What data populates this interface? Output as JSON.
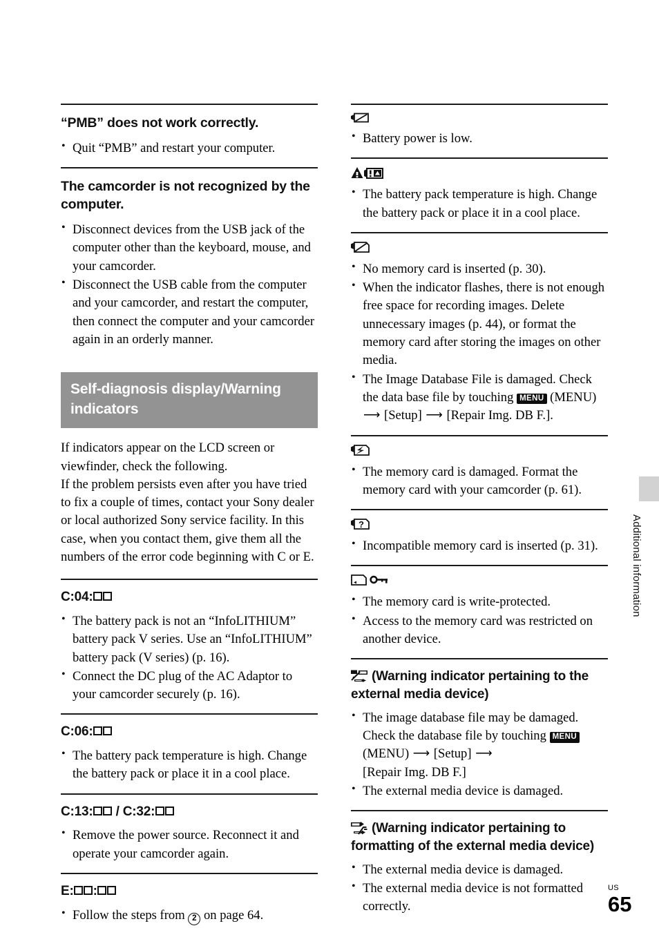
{
  "page": {
    "folio_region": "US",
    "folio_number": "65",
    "side_tab_label": "Additional information",
    "banner_color": "#939393",
    "side_tab_color": "#d2d2d2"
  },
  "left_column": {
    "sections": [
      {
        "id": "pmb-not-working",
        "heading": "“PMB” does not work correctly.",
        "bullets": [
          "Quit “PMB” and restart your computer."
        ]
      },
      {
        "id": "camcorder-not-recognized",
        "heading": "The camcorder is not recognized by the computer.",
        "bullets": [
          "Disconnect devices from the USB jack of the computer other than the keyboard, mouse, and your camcorder.",
          "Disconnect the USB cable from the computer and your camcorder, and restart the computer, then connect the computer and your camcorder again in an orderly manner."
        ]
      }
    ],
    "banner_title": "Self-diagnosis display/Warning indicators",
    "intro_paragraph": "If indicators appear on the LCD screen or viewfinder, check the following.\nIf the problem persists even after you have tried to fix a couple of times, contact your Sony dealer or local authorized Sony service facility. In this case, when you contact them, give them all the numbers of the error code beginning with C or E.",
    "code_sections": [
      {
        "id": "c04",
        "code_prefix": "C:04:",
        "boxes": 2,
        "bullets": [
          "The battery pack is not an “InfoLITHIUM” battery pack V series. Use an “InfoLITHIUM” battery pack (V series) (p. 16).",
          "Connect the DC plug of the AC Adaptor to your camcorder securely (p. 16)."
        ]
      },
      {
        "id": "c06",
        "code_prefix": "C:06:",
        "boxes": 2,
        "bullets": [
          "The battery pack temperature is high. Change the battery pack or place it in a cool place."
        ]
      },
      {
        "id": "c13-c32",
        "code_prefix": "C:13:",
        "code_suffix": " / C:32:",
        "boxes": 2,
        "bullets": [
          "Remove the power source. Reconnect it and operate your camcorder again."
        ]
      },
      {
        "id": "e-code",
        "code_prefix": "E:",
        "code_mid": ":",
        "boxes": 2,
        "bullets_prefix": "Follow the steps from ",
        "bullets_circled": "2",
        "bullets_suffix": " on page 64."
      }
    ]
  },
  "right_column": {
    "sections": [
      {
        "id": "battery-low",
        "icon": "battery-low-icon",
        "bullets": [
          "Battery power is low."
        ]
      },
      {
        "id": "battery-temp-high",
        "icon": "battery-temperature-warning-icon",
        "bullets": [
          "The battery pack temperature is high. Change the battery pack or place it in a cool place."
        ]
      },
      {
        "id": "no-memory-card",
        "icon": "no-memory-card-icon",
        "bullets": [
          "No memory card is inserted (p. 30).",
          "When the indicator flashes, there is not enough free space for recording images. Delete unnecessary images (p. 44), or format the memory card after storing the images on other media."
        ],
        "bullet_menu": {
          "before": "The Image Database File is damaged. Check the data base file by touching ",
          "menu_label": "MENU",
          "middle": " (MENU) ",
          "after_arrow_1": " [Setup] ",
          "after_arrow_2": " [Repair Img. DB F.]."
        }
      },
      {
        "id": "memory-card-damaged",
        "icon": "memory-card-damaged-icon",
        "bullets": [
          "The memory card is damaged. Format the memory card with your camcorder (p. 61)."
        ]
      },
      {
        "id": "incompatible-memory-card",
        "icon": "incompatible-memory-card-icon",
        "bullets": [
          "Incompatible memory card is inserted (p. 31)."
        ]
      },
      {
        "id": "memory-card-write-protected",
        "icon": "memory-card-write-protect-icon",
        "bullets": [
          "The memory card is write-protected.",
          "Access to the memory card was restricted on another device."
        ]
      },
      {
        "id": "external-media-warning",
        "icon": "external-media-warning-icon",
        "heading": "(Warning indicator pertaining to the external media device)",
        "bullet_menu": {
          "before": "The image database file may be damaged. Check the database file by touching ",
          "menu_label": "MENU",
          "middle": " (MENU) ",
          "after_arrow_1": " [Setup] ",
          "after_arrow_2": " [Repair Img. DB F.]"
        },
        "bullets": [
          "The external media device is damaged."
        ]
      },
      {
        "id": "external-media-format-warning",
        "icon": "external-media-format-warning-icon",
        "heading": "(Warning indicator pertaining to formatting of the external media device)",
        "bullets": [
          "The external media device is damaged.",
          "The external media device is not formatted correctly."
        ]
      }
    ]
  }
}
